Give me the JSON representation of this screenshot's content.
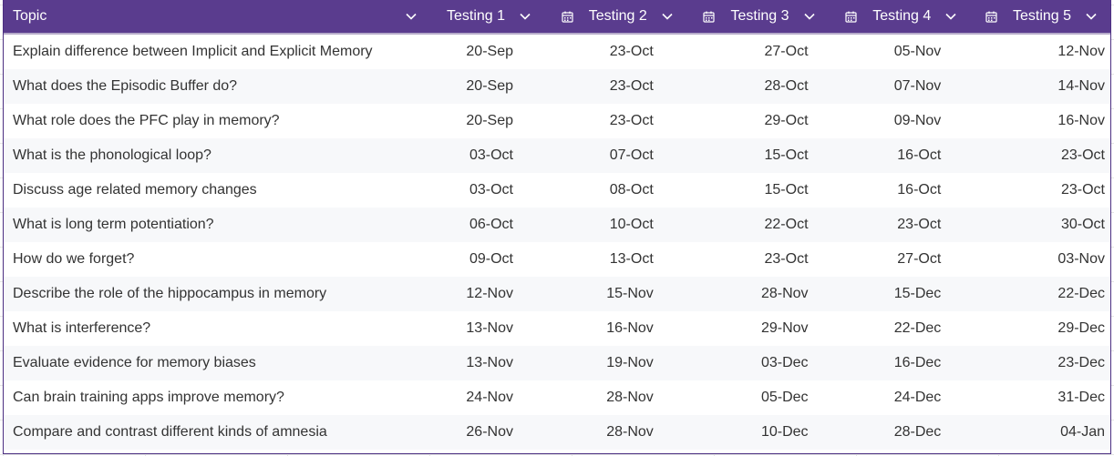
{
  "colors": {
    "header_bg": "#5a3c8e",
    "header_text": "#ffffff",
    "row_alt": "#f7f8fa",
    "text": "#333333"
  },
  "header": {
    "topic": "Topic",
    "testing_1": "Testing 1",
    "testing_2": "Testing 2",
    "testing_3": "Testing 3",
    "testing_4": "Testing 4",
    "testing_5": "Testing 5"
  },
  "rows": [
    {
      "topic": "Explain difference between Implicit and Explicit Memory",
      "t1": "20-Sep",
      "t2": "23-Oct",
      "t3": "27-Oct",
      "t4": "05-Nov",
      "t5": "12-Nov"
    },
    {
      "topic": "What does the Episodic Buffer do?",
      "t1": "20-Sep",
      "t2": "23-Oct",
      "t3": "28-Oct",
      "t4": "07-Nov",
      "t5": "14-Nov"
    },
    {
      "topic": "What role does the PFC play in memory?",
      "t1": "20-Sep",
      "t2": "23-Oct",
      "t3": "29-Oct",
      "t4": "09-Nov",
      "t5": "16-Nov"
    },
    {
      "topic": "What is the phonological loop?",
      "t1": "03-Oct",
      "t2": "07-Oct",
      "t3": "15-Oct",
      "t4": "16-Oct",
      "t5": "23-Oct"
    },
    {
      "topic": "Discuss age related memory changes",
      "t1": "03-Oct",
      "t2": "08-Oct",
      "t3": "15-Oct",
      "t4": "16-Oct",
      "t5": "23-Oct"
    },
    {
      "topic": "What is long term potentiation?",
      "t1": "06-Oct",
      "t2": "10-Oct",
      "t3": "22-Oct",
      "t4": "23-Oct",
      "t5": "30-Oct"
    },
    {
      "topic": "How do we forget?",
      "t1": "09-Oct",
      "t2": "13-Oct",
      "t3": "23-Oct",
      "t4": "27-Oct",
      "t5": "03-Nov"
    },
    {
      "topic": "Describe the role of the hippocampus in memory",
      "t1": "12-Nov",
      "t2": "15-Nov",
      "t3": "28-Nov",
      "t4": "15-Dec",
      "t5": "22-Dec"
    },
    {
      "topic": "What is interference?",
      "t1": "13-Nov",
      "t2": "16-Nov",
      "t3": "29-Nov",
      "t4": "22-Dec",
      "t5": "29-Dec"
    },
    {
      "topic": "Evaluate evidence for memory biases",
      "t1": "13-Nov",
      "t2": "19-Nov",
      "t3": "03-Dec",
      "t4": "16-Dec",
      "t5": "23-Dec"
    },
    {
      "topic": "Can brain training apps improve memory?",
      "t1": "24-Nov",
      "t2": "28-Nov",
      "t3": "05-Dec",
      "t4": "24-Dec",
      "t5": "31-Dec"
    },
    {
      "topic": "Compare and contrast different kinds of amnesia",
      "t1": "26-Nov",
      "t2": "28-Nov",
      "t3": "10-Dec",
      "t4": "28-Dec",
      "t5": "04-Jan"
    }
  ]
}
